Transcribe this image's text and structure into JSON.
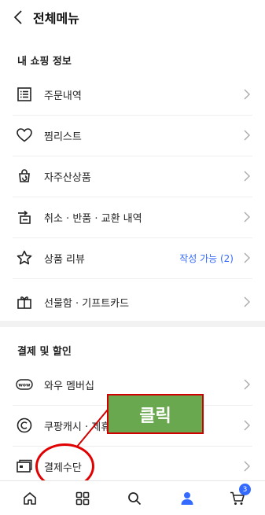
{
  "header": {
    "title": "전체메뉴"
  },
  "sections": [
    {
      "title": "내 쇼핑 정보",
      "items": [
        {
          "label": "주문내역",
          "icon": "list-icon"
        },
        {
          "label": "찜리스트",
          "icon": "heart-icon"
        },
        {
          "label": "자주산상품",
          "icon": "repeat-bag-icon"
        },
        {
          "label": "취소 · 반품 · 교환 내역",
          "icon": "return-icon"
        },
        {
          "label": "상품 리뷰",
          "icon": "star-icon",
          "extra": "작성 가능 (2)"
        },
        {
          "label": "선물함 · 기프트카드",
          "icon": "gift-icon"
        }
      ]
    },
    {
      "title": "결제 및 할인",
      "items": [
        {
          "label": "와우 멤버십",
          "icon": "wow-icon"
        },
        {
          "label": "쿠팡캐시 · 제휴",
          "icon": "copyright-cash-icon"
        },
        {
          "label": "결제수단",
          "icon": "card-icon"
        }
      ]
    }
  ],
  "bottom_nav": {
    "cart_count": "3",
    "active_tab": "my-page",
    "accent_color": "#346aff"
  },
  "annotation": {
    "label": "클릭",
    "box_color": "#6aa84f",
    "outline_color": "#e10000"
  }
}
